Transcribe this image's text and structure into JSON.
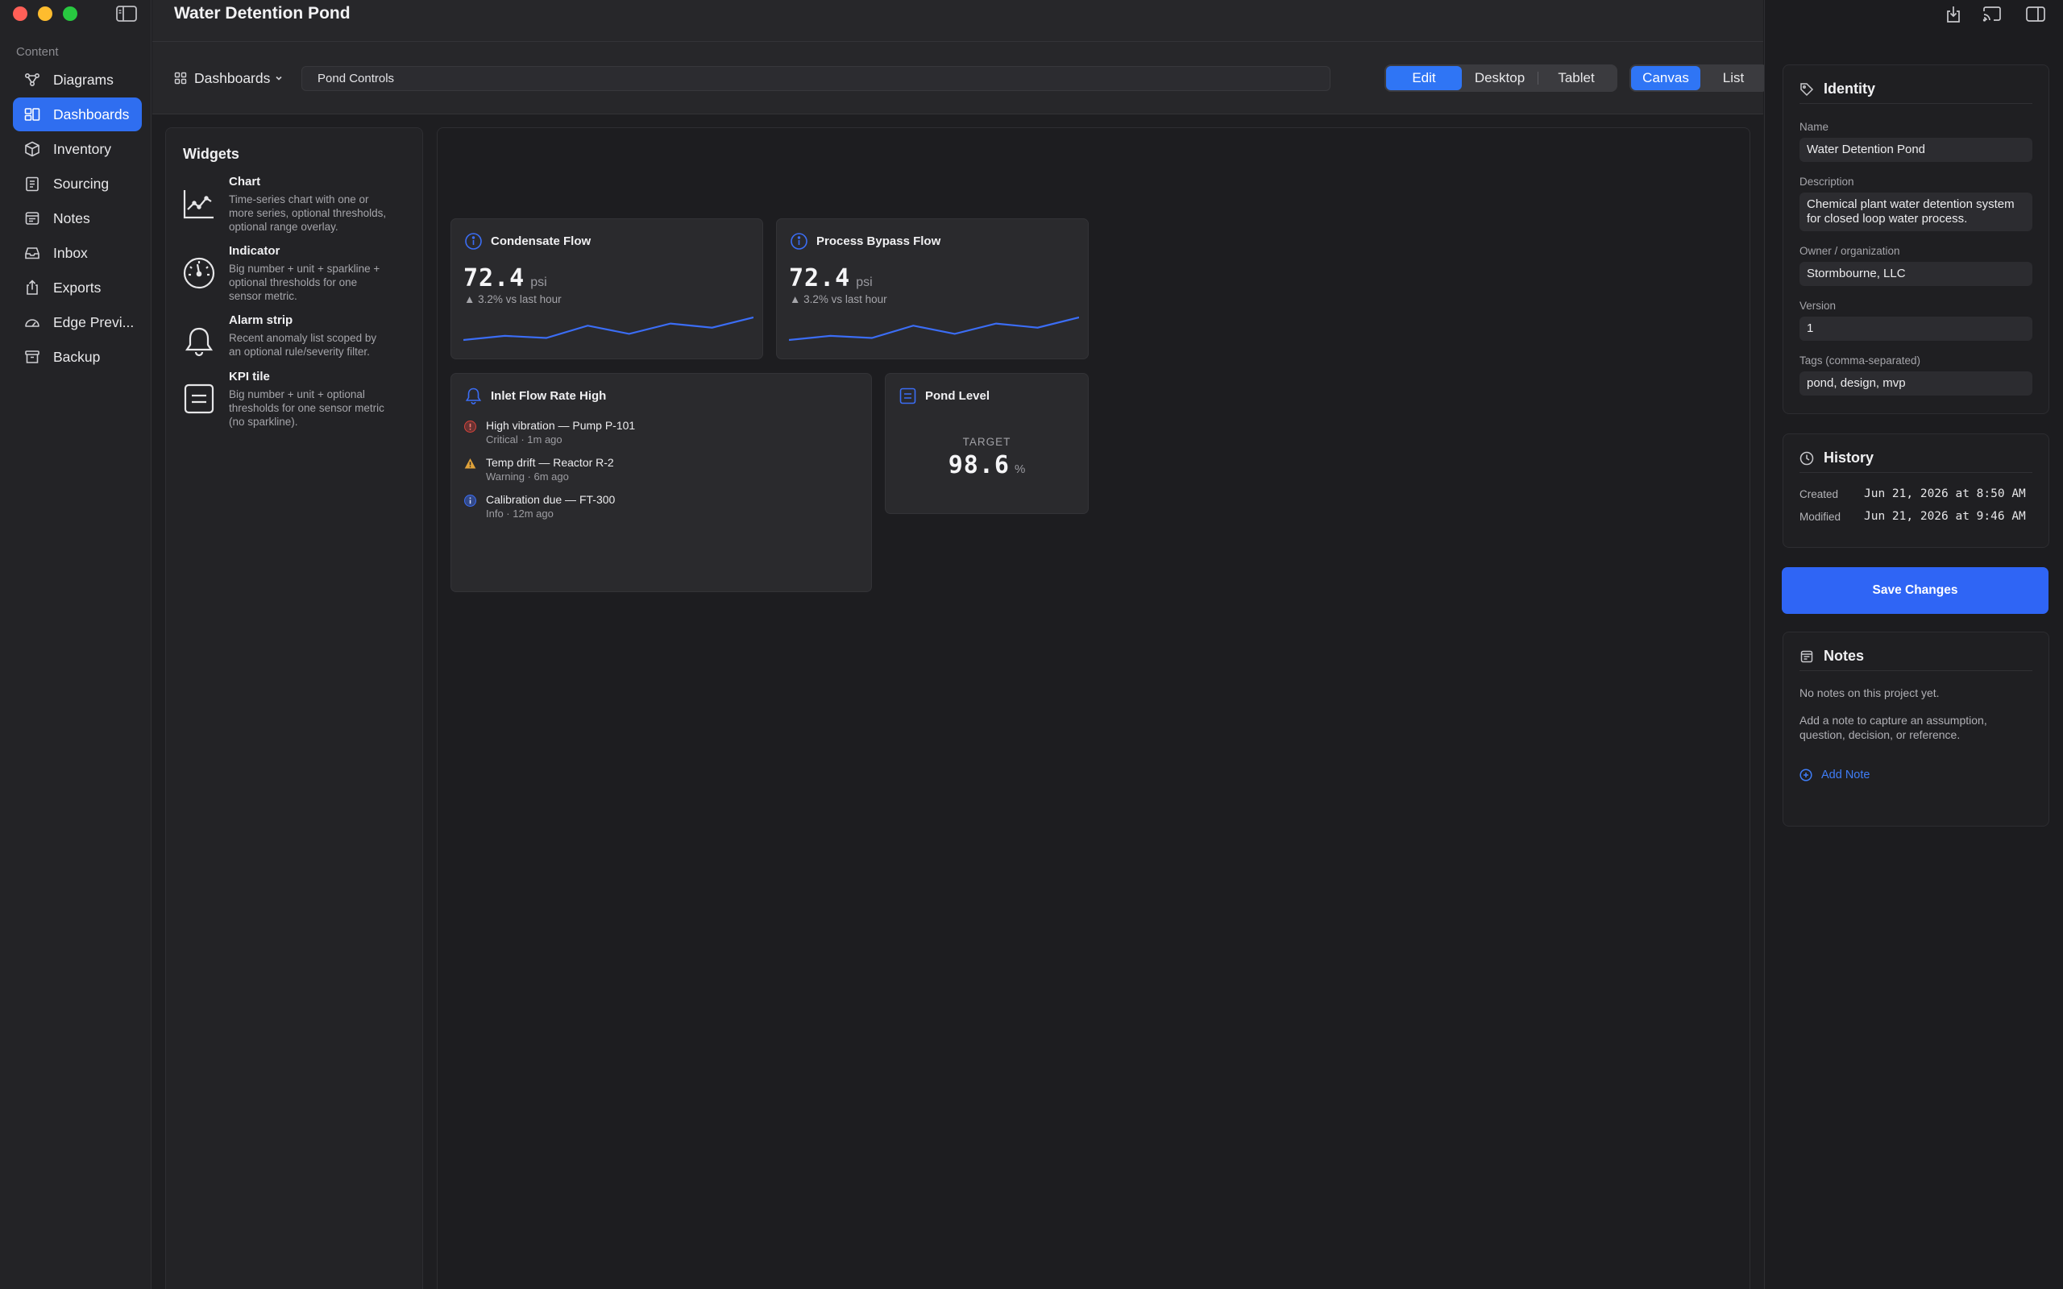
{
  "window": {
    "title": "Water Detention Pond"
  },
  "sidebar": {
    "section_label": "Content",
    "items": [
      {
        "label": "Diagrams",
        "icon": "diagram-icon",
        "active": false
      },
      {
        "label": "Dashboards",
        "icon": "dashboard-icon",
        "active": true
      },
      {
        "label": "Inventory",
        "icon": "box-icon",
        "active": false
      },
      {
        "label": "Sourcing",
        "icon": "clipboard-icon",
        "active": false
      },
      {
        "label": "Notes",
        "icon": "note-icon",
        "active": false
      },
      {
        "label": "Inbox",
        "icon": "inbox-icon",
        "active": false
      },
      {
        "label": "Exports",
        "icon": "export-icon",
        "active": false
      },
      {
        "label": "Edge Previ...",
        "icon": "gauge-icon",
        "active": false
      },
      {
        "label": "Backup",
        "icon": "archive-icon",
        "active": false
      }
    ]
  },
  "toolbar": {
    "dashboards_menu": "Dashboards",
    "dashboard_name": "Pond Controls",
    "layout_modes": [
      "Edit",
      "Desktop",
      "Tablet"
    ],
    "layout_selected": "Edit",
    "view_modes": [
      "Canvas",
      "List"
    ],
    "view_selected": "Canvas"
  },
  "widgets_panel": {
    "title": "Widgets",
    "items": [
      {
        "name": "Chart",
        "icon": "line-chart-icon",
        "description": "Time-series chart with one or more series, optional thresholds, optional range overlay."
      },
      {
        "name": "Indicator",
        "icon": "gauge-dial-icon",
        "description": "Big number + unit + sparkline + optional thresholds for one sensor metric."
      },
      {
        "name": "Alarm strip",
        "icon": "bell-icon",
        "description": "Recent anomaly list scoped by an optional rule/severity filter."
      },
      {
        "name": "KPI tile",
        "icon": "tile-icon",
        "description": "Big number + unit + optional thresholds for one sensor metric (no sparkline)."
      }
    ]
  },
  "canvas": {
    "indicators": [
      {
        "title": "Condensate Flow",
        "value": "72.4",
        "unit": "psi",
        "delta": "▲ 3.2% vs last hour",
        "spark": [
          4,
          6,
          5,
          11,
          7,
          12,
          10,
          15
        ],
        "spark_color": "#3b6df5"
      },
      {
        "title": "Process Bypass Flow",
        "value": "72.4",
        "unit": "psi",
        "delta": "▲ 3.2% vs last hour",
        "spark": [
          4,
          6,
          5,
          11,
          7,
          12,
          10,
          15
        ],
        "spark_color": "#3b6df5"
      }
    ],
    "alarm_strip": {
      "title": "Inlet Flow Rate High",
      "alarms": [
        {
          "title": "High vibration — Pump P-101",
          "sub": "Critical · 1m ago",
          "severity": "critical",
          "color": "#d9433b"
        },
        {
          "title": "Temp drift — Reactor R-2",
          "sub": "Warning · 6m ago",
          "severity": "warning",
          "color": "#e0a23a"
        },
        {
          "title": "Calibration due — FT-300",
          "sub": "Info · 12m ago",
          "severity": "info",
          "color": "#3b6df5"
        }
      ]
    },
    "kpi": {
      "title": "Pond Level",
      "label": "TARGET",
      "value": "98.6",
      "unit": "%"
    }
  },
  "inspector": {
    "identity": {
      "title": "Identity",
      "name_label": "Name",
      "name_value": "Water Detention Pond",
      "description_label": "Description",
      "description_value": "Chemical plant water detention system for closed loop water process.",
      "owner_label": "Owner / organization",
      "owner_value": "Stormbourne, LLC",
      "version_label": "Version",
      "version_value": "1",
      "tags_label": "Tags (comma-separated)",
      "tags_value": "pond, design, mvp"
    },
    "history": {
      "title": "History",
      "created_label": "Created",
      "created_value": "Jun 21, 2026 at 8:50 AM",
      "modified_label": "Modified",
      "modified_value": "Jun 21, 2026 at 9:46 AM"
    },
    "save_label": "Save Changes",
    "notes": {
      "title": "Notes",
      "empty": "No notes on this project yet.",
      "hint": "Add a note to capture an assumption, question, decision, or reference.",
      "add_label": "Add Note"
    }
  },
  "colors": {
    "accent": "#2f6ef0",
    "critical": "#d9433b",
    "warning": "#e0a23a",
    "info": "#3b6df5"
  }
}
